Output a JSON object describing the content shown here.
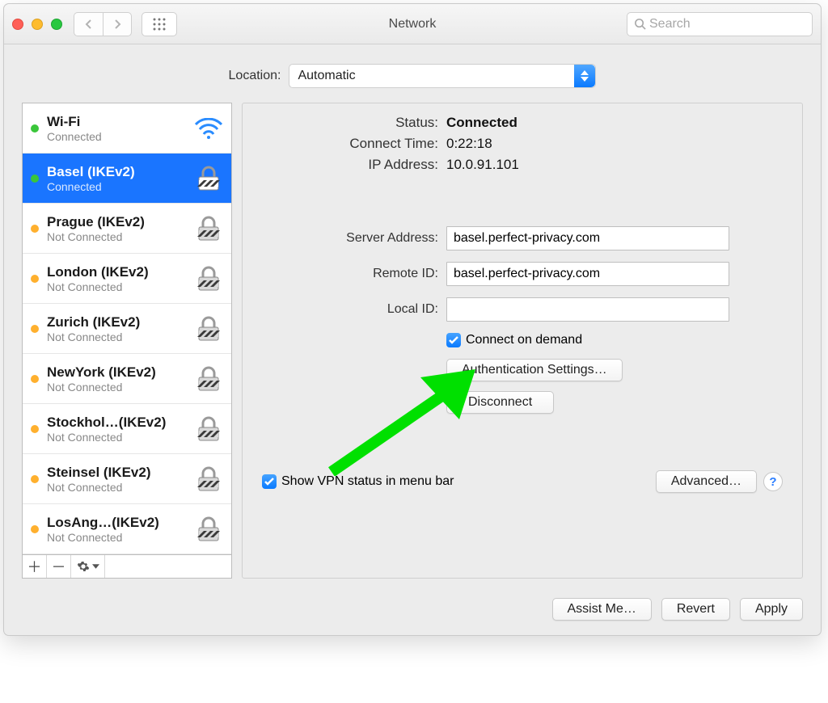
{
  "window": {
    "title": "Network",
    "search_placeholder": "Search"
  },
  "location": {
    "label": "Location:",
    "selected": "Automatic"
  },
  "connections": [
    {
      "name": "Wi-Fi",
      "status": "Connected",
      "dot": "green",
      "type": "wifi"
    },
    {
      "name": "Basel (IKEv2)",
      "status": "Connected",
      "dot": "green",
      "type": "vpn"
    },
    {
      "name": "Prague (IKEv2)",
      "status": "Not Connected",
      "dot": "amber",
      "type": "vpn"
    },
    {
      "name": "London (IKEv2)",
      "status": "Not Connected",
      "dot": "amber",
      "type": "vpn"
    },
    {
      "name": "Zurich (IKEv2)",
      "status": "Not Connected",
      "dot": "amber",
      "type": "vpn"
    },
    {
      "name": "NewYork (IKEv2)",
      "status": "Not Connected",
      "dot": "amber",
      "type": "vpn"
    },
    {
      "name": "Stockhol…(IKEv2)",
      "status": "Not Connected",
      "dot": "amber",
      "type": "vpn"
    },
    {
      "name": "Steinsel (IKEv2)",
      "status": "Not Connected",
      "dot": "amber",
      "type": "vpn"
    },
    {
      "name": "LosAng…(IKEv2)",
      "status": "Not Connected",
      "dot": "amber",
      "type": "vpn"
    }
  ],
  "selected_index": 1,
  "detail": {
    "status_label": "Status:",
    "status_value": "Connected",
    "connect_time_label": "Connect Time:",
    "connect_time_value": "0:22:18",
    "ip_label": "IP Address:",
    "ip_value": "10.0.91.101",
    "server_address_label": "Server Address:",
    "server_address_value": "basel.perfect-privacy.com",
    "remote_id_label": "Remote ID:",
    "remote_id_value": "basel.perfect-privacy.com",
    "local_id_label": "Local ID:",
    "local_id_value": "",
    "connect_on_demand": "Connect on demand",
    "auth_settings": "Authentication Settings…",
    "disconnect": "Disconnect",
    "show_vpn_menubar": "Show VPN status in menu bar",
    "advanced": "Advanced…"
  },
  "footer": {
    "assist": "Assist Me…",
    "revert": "Revert",
    "apply": "Apply"
  }
}
